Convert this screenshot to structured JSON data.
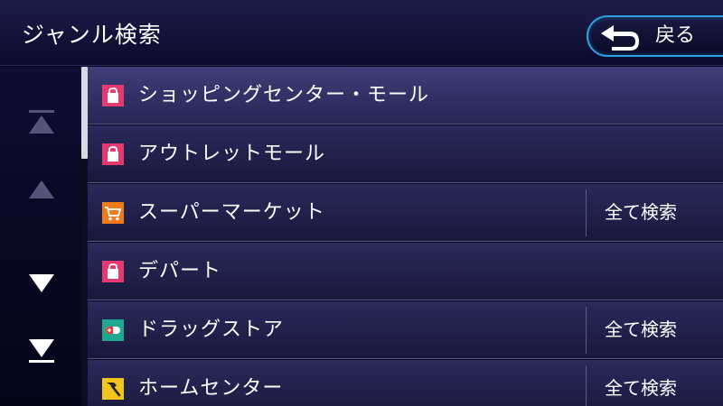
{
  "header": {
    "title": "ジャンル検索",
    "back_label": "戻る"
  },
  "colors": {
    "accent": "#2aa3e4",
    "shop_icon": "#e63a6e",
    "cart_icon": "#f07a1e",
    "drug_icon": "#1fa88f",
    "tool_icon": "#f0c51e"
  },
  "list": {
    "rows": [
      {
        "label": "ショッピングセンター・モール",
        "icon": "shopping-bag-icon",
        "action": ""
      },
      {
        "label": "アウトレットモール",
        "icon": "shopping-bag-icon",
        "action": ""
      },
      {
        "label": "スーパーマーケット",
        "icon": "shopping-cart-icon",
        "action": "全て検索"
      },
      {
        "label": "デパート",
        "icon": "shopping-bag-icon",
        "action": ""
      },
      {
        "label": "ドラッグストア",
        "icon": "pill-icon",
        "action": "全て検索"
      },
      {
        "label": "ホームセンター",
        "icon": "hammer-icon",
        "action": "全て検索"
      }
    ]
  }
}
